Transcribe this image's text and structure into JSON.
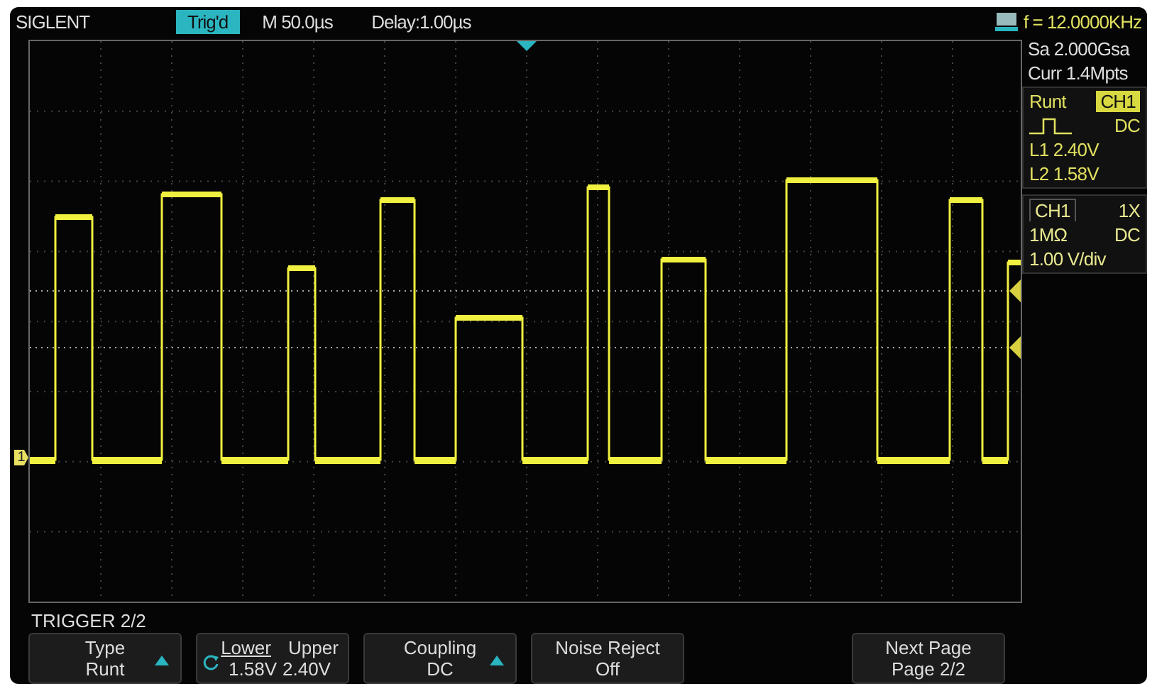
{
  "top_bar": {
    "brand": "SIGLENT",
    "status": "Trig'd",
    "timebase": "M 50.0µs",
    "delay": "Delay:1.00µs",
    "frequency": "f = 12.0000KHz"
  },
  "channel_marker": "1",
  "side_panel": {
    "sample_rate": "Sa 2.000Gsa",
    "memory": "Curr 1.4Mpts",
    "trigger": {
      "type": "Runt",
      "source": "CH1",
      "coupling": "DC",
      "levels": [
        "L1 2.40V",
        "L2 1.58V"
      ]
    },
    "channel": {
      "name": "CH1",
      "probe": "1X",
      "impedance": "1MΩ",
      "coupling": "DC",
      "scale": "1.00 V/div"
    }
  },
  "menu_title": "TRIGGER 2/2",
  "softkeys": [
    {
      "kind": "value",
      "label": "Type",
      "value": "Runt",
      "arrow": true
    },
    {
      "kind": "pair",
      "options": [
        {
          "label": "Lower",
          "value": "1.58V",
          "selected": true
        },
        {
          "label": "Upper",
          "value": "2.40V",
          "selected": false
        }
      ]
    },
    {
      "kind": "value",
      "label": "Coupling",
      "value": "DC",
      "arrow": true
    },
    {
      "kind": "value",
      "label": "Noise Reject",
      "value": "Off",
      "arrow": false
    },
    {
      "kind": "page",
      "label": "Next Page",
      "value": "Page 2/2",
      "arrow": false
    }
  ]
}
